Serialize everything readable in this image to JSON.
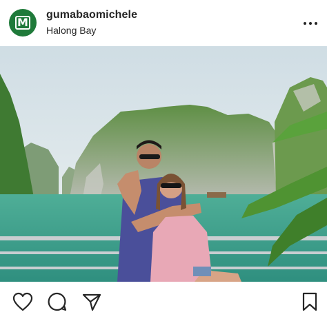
{
  "post": {
    "username": "gumabaomichele",
    "location": "Halong Bay",
    "avatar_icon": "gumabao-logo-icon"
  },
  "actions": {
    "icons": [
      "heart-icon",
      "comment-icon",
      "share-icon",
      "bookmark-icon"
    ]
  },
  "colors": {
    "text": "#262626",
    "avatar_bg": "#1f7a3a",
    "water": "#3a9e8c",
    "sky": "#dfe8ec"
  }
}
